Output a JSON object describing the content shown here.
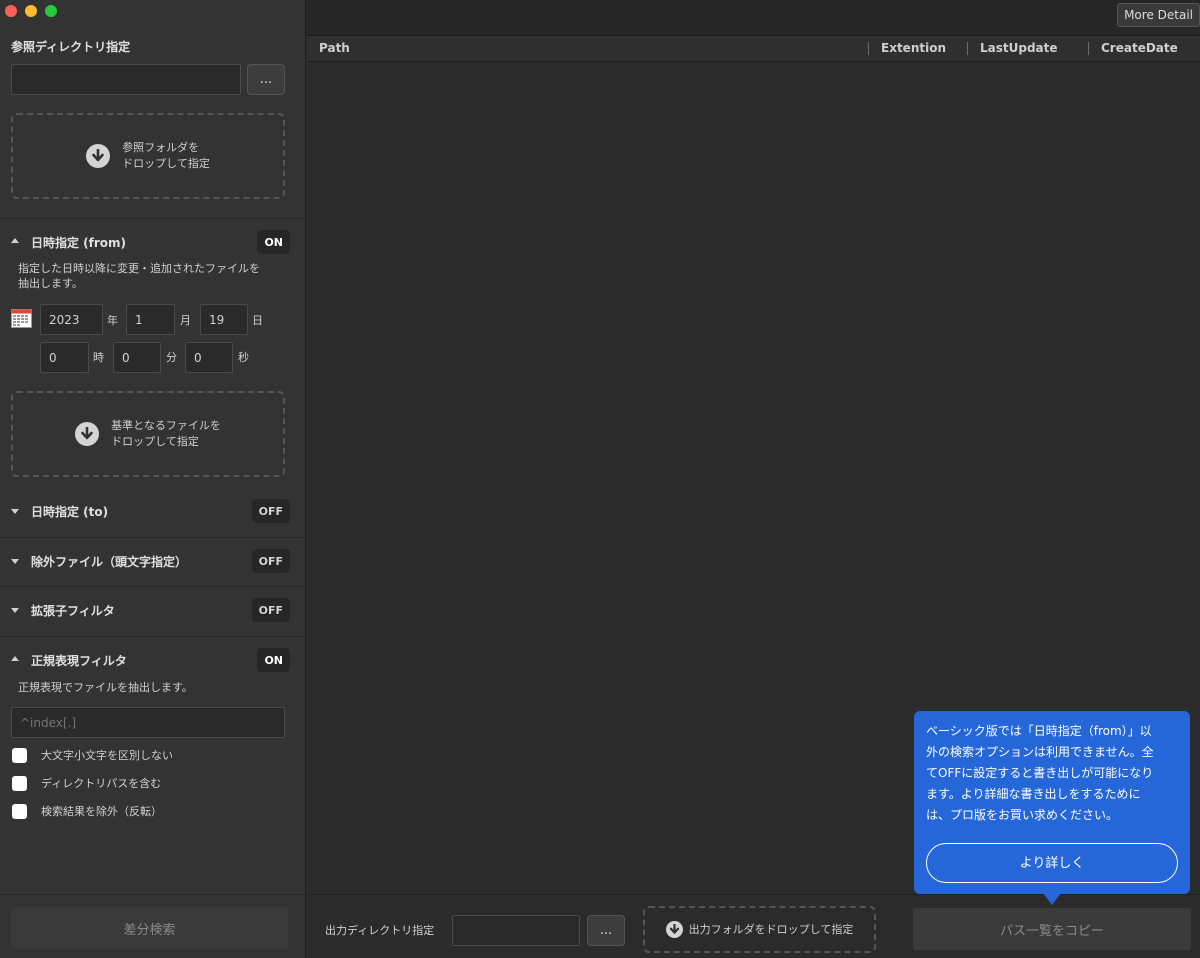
{
  "sidebar": {
    "ref_dir": {
      "title": "参照ディレクトリ指定",
      "path_value": "",
      "browse_label": "...",
      "drop_line1": "参照フォルダを",
      "drop_line2": "ドロップして指定"
    },
    "date_from": {
      "title": "日時指定 (from)",
      "toggle": "ON",
      "description_line1": "指定した日時以降に変更・追加されたファイルを",
      "description_line2": "抽出します。",
      "year": "2023",
      "year_unit": "年",
      "month": "1",
      "month_unit": "月",
      "day": "19",
      "day_unit": "日",
      "hour": "0",
      "hour_unit": "時",
      "minute": "0",
      "minute_unit": "分",
      "second": "0",
      "second_unit": "秒",
      "drop_line1": "基準となるファイルを",
      "drop_line2": "ドロップして指定"
    },
    "date_to": {
      "title": "日時指定 (to)",
      "toggle": "OFF"
    },
    "exclude": {
      "title": "除外ファイル（頭文字指定）",
      "toggle": "OFF"
    },
    "extension": {
      "title": "拡張子フィルタ",
      "toggle": "OFF"
    },
    "regex": {
      "title": "正規表現フィルタ",
      "toggle": "ON",
      "description": "正規表現でファイルを抽出します。",
      "placeholder": "^index[.]",
      "options": [
        "大文字小文字を区別しない",
        "ディレクトリパスを含む",
        "検索結果を除外（反転）"
      ]
    },
    "search_button": "差分検索"
  },
  "topbar": {
    "more_detail": "More Detail"
  },
  "table": {
    "columns": [
      "Path",
      "Extention",
      "LastUpdate",
      "CreateDate"
    ]
  },
  "footer": {
    "out_label": "出力ディレクトリ指定",
    "out_value": "",
    "browse_label": "...",
    "drop_label": "出力フォルダをドロップして指定",
    "copy_button": "パス一覧をコピー"
  },
  "tooltip": {
    "lines": [
      "ベーシック版では「日時指定（from）」以",
      "外の検索オプションは利用できません。全",
      "てOFFに設定すると書き出しが可能になり",
      "ます。より詳細な書き出しをするために",
      "は、プロ版をお買い求めください。"
    ],
    "button": "より詳しく"
  },
  "colors": {
    "accent": "#2567d8",
    "background": "#2b2b2b",
    "sidebar": "#333333"
  }
}
